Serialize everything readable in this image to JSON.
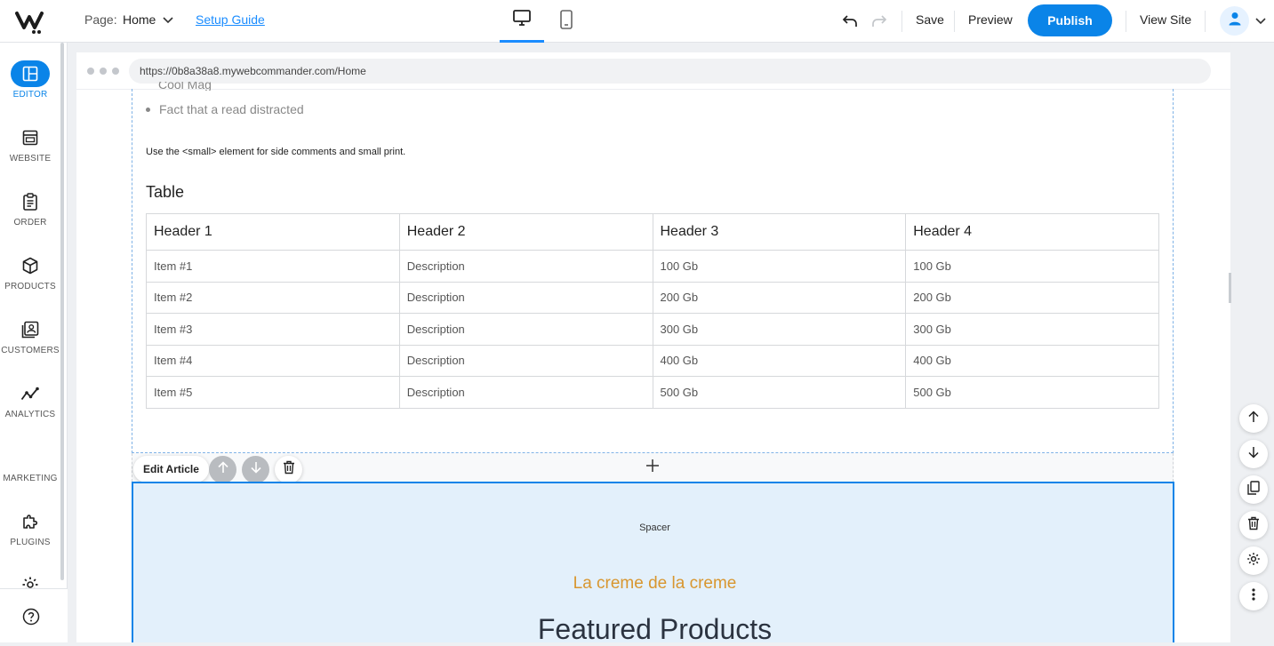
{
  "topbar": {
    "page_label": "Page:",
    "page_value": "Home",
    "setup_guide": "Setup Guide",
    "save": "Save",
    "preview": "Preview",
    "publish": "Publish",
    "view_site": "View Site"
  },
  "sidebar": {
    "items": [
      {
        "label": "EDITOR",
        "icon": "layout-icon"
      },
      {
        "label": "WEBSITE",
        "icon": "browser-window-icon"
      },
      {
        "label": "ORDER",
        "icon": "clipboard-icon"
      },
      {
        "label": "PRODUCTS",
        "icon": "box-icon"
      },
      {
        "label": "CUSTOMERS",
        "icon": "customer-icon"
      },
      {
        "label": "ANALYTICS",
        "icon": "analytics-icon"
      },
      {
        "label": "MARKETING",
        "icon": ""
      },
      {
        "label": "PLUGINS",
        "icon": "puzzle-icon"
      }
    ]
  },
  "browser": {
    "url": "https://0b8a38a8.mywebcommander.com/Home"
  },
  "content": {
    "bullet": "Fact that a read distracted",
    "small_print": "Use the <small> element for side comments and small print.",
    "table_title": "Table",
    "table": {
      "headers": [
        "Header 1",
        "Header 2",
        "Header 3",
        "Header 4"
      ],
      "rows": [
        [
          "Item #1",
          "Description",
          "100 Gb",
          "100 Gb"
        ],
        [
          "Item #2",
          "Description",
          "200 Gb",
          "200 Gb"
        ],
        [
          "Item #3",
          "Description",
          "300 Gb",
          "300 Gb"
        ],
        [
          "Item #4",
          "Description",
          "400 Gb",
          "400 Gb"
        ],
        [
          "Item #5",
          "Description",
          "500 Gb",
          "500 Gb"
        ]
      ]
    },
    "edit_article": "Edit Article",
    "spacer": "Spacer",
    "subtitle": "La creme de la creme",
    "featured_title": "Featured Products"
  },
  "colors": {
    "accent": "#0a84e8",
    "subtitle": "#d8962f",
    "section_bg": "#e3f0fb"
  }
}
